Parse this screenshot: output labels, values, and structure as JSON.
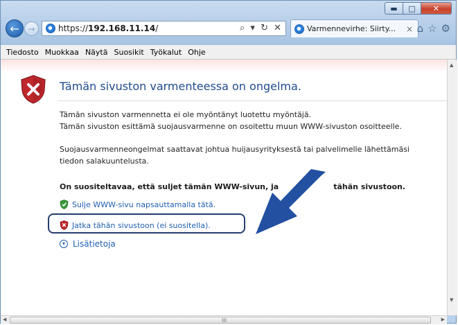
{
  "window": {
    "caption_buttons": {
      "minimize": "▬",
      "maximize": "□",
      "close": "✕"
    }
  },
  "navbar": {
    "back_glyph": "←",
    "forward_glyph": "→",
    "address_scheme": "https://",
    "address_host": "192.168.11.14",
    "address_path": "/",
    "address_tools": "⌕ ▾ ↻ ✕",
    "tab_title": "Varmennevirhe: Siirty...",
    "tab_close": "×",
    "right_icons": [
      "home-icon",
      "favorites-star-icon",
      "settings-gear-icon"
    ],
    "right_icon_glyphs": {
      "home": "⌂",
      "star": "☆",
      "gear": "⚙"
    }
  },
  "menubar": {
    "items": [
      "Tiedosto",
      "Muokkaa",
      "Näytä",
      "Suosikit",
      "Työkalut",
      "Ohje"
    ]
  },
  "page": {
    "heading": "Tämän sivuston varmenteessa on ongelma.",
    "para1_line1": "Tämän sivuston varmennetta ei ole myöntänyt luotettu myöntäjä.",
    "para1_line2": "Tämän sivuston esittämä suojausvarmenne on osoitettu muun WWW-sivuston osoitteelle.",
    "para2": "Suojausvarmenneongelmat saattavat johtua huijausyrityksestä tai palvelimelle lähettämäsi tiedon salakuuntelusta.",
    "recommendation_start": "On suositeltavaa, että suljet tämän WWW-sivun, ja",
    "recommendation_end": "tähän sivustoon.",
    "link_close": "Sulje WWW-sivu napsauttamalla tätä.",
    "link_continue": "Jatka tähän sivustoon (ei suositella).",
    "more_info": "Lisätietoja",
    "more_info_glyph": "▾"
  },
  "colors": {
    "accent_blue": "#1f4b8c",
    "link_blue": "#1f5fb0",
    "error_red": "#c0282d",
    "ok_green": "#3a9a3a",
    "annotation_arrow": "#2350a0"
  },
  "scrollbars": {
    "vertical_up": "▲",
    "vertical_down": "▼",
    "horizontal_left": "◀",
    "horizontal_right": "▶",
    "grip": "III"
  }
}
